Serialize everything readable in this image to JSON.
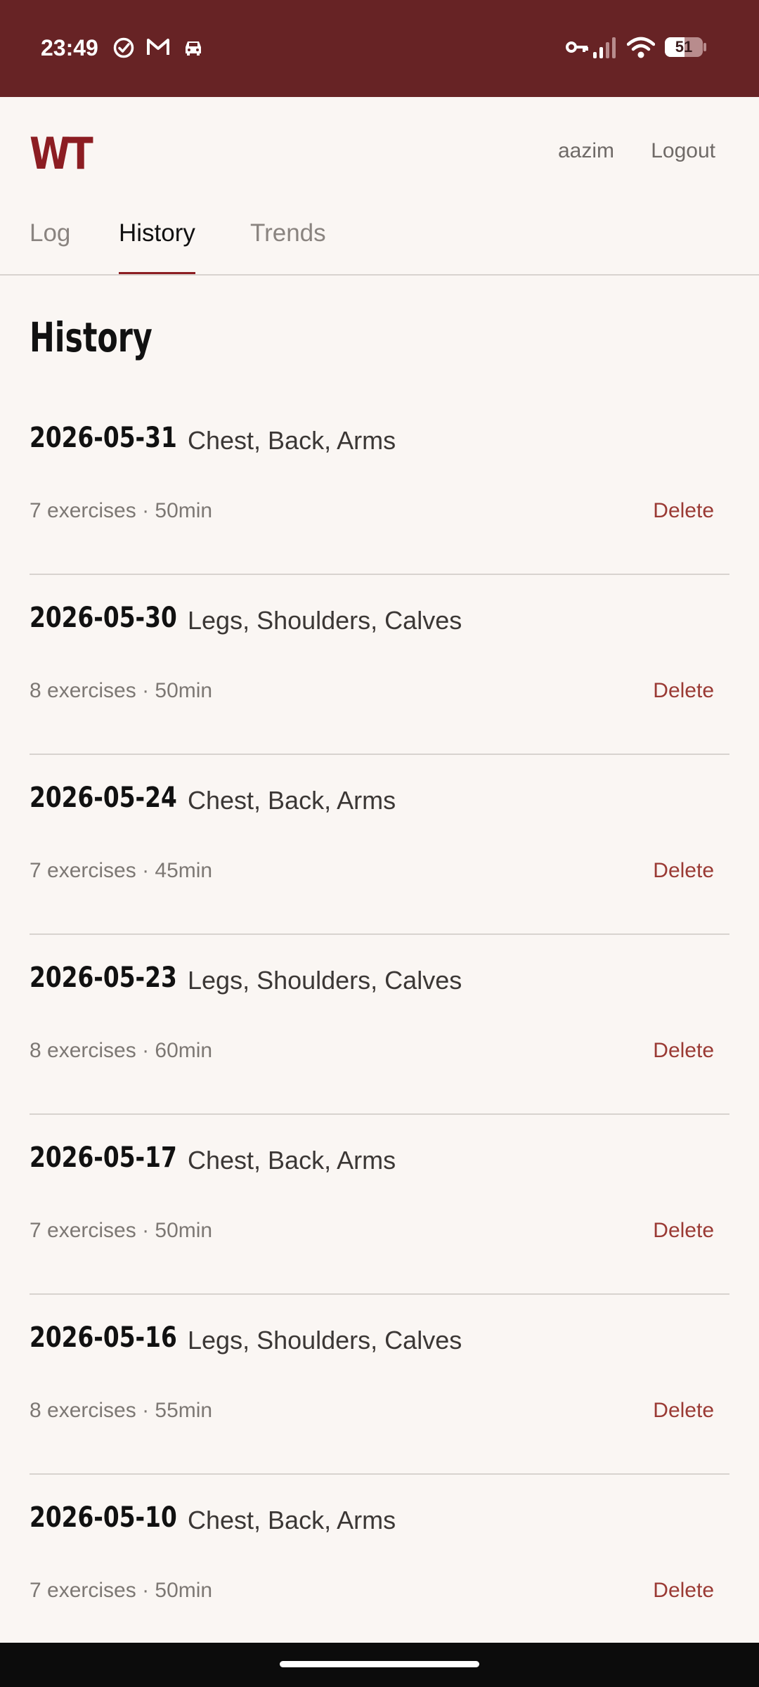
{
  "status_bar": {
    "time": "23:49",
    "battery": "51",
    "icons": [
      "check-circle-icon",
      "gmail-icon",
      "car-icon",
      "vpn-key-icon",
      "signal-icon",
      "wifi-icon",
      "battery-icon"
    ]
  },
  "header": {
    "logo": "WT",
    "username": "aazim",
    "logout_label": "Logout"
  },
  "tabs": [
    {
      "label": "Log",
      "active": false
    },
    {
      "label": "History",
      "active": true
    },
    {
      "label": "Trends",
      "active": false
    }
  ],
  "page_title": "History",
  "sessions": [
    {
      "date": "2026-05-31",
      "groups": "Chest, Back, Arms",
      "meta": "7 exercises · 50min",
      "delete_label": "Delete"
    },
    {
      "date": "2026-05-30",
      "groups": "Legs, Shoulders, Calves",
      "meta": "8 exercises · 50min",
      "delete_label": "Delete"
    },
    {
      "date": "2026-05-24",
      "groups": "Chest, Back, Arms",
      "meta": "7 exercises · 45min",
      "delete_label": "Delete"
    },
    {
      "date": "2026-05-23",
      "groups": "Legs, Shoulders, Calves",
      "meta": "8 exercises · 60min",
      "delete_label": "Delete"
    },
    {
      "date": "2026-05-17",
      "groups": "Chest, Back, Arms",
      "meta": "7 exercises · 50min",
      "delete_label": "Delete"
    },
    {
      "date": "2026-05-16",
      "groups": "Legs, Shoulders, Calves",
      "meta": "8 exercises · 55min",
      "delete_label": "Delete"
    },
    {
      "date": "2026-05-10",
      "groups": "Chest, Back, Arms",
      "meta": "7 exercises · 50min",
      "delete_label": "Delete"
    }
  ],
  "colors": {
    "status_bar_bg": "#672325",
    "accent": "#8c1d22",
    "delete": "#9a3a34",
    "page_bg": "#faf6f3"
  }
}
